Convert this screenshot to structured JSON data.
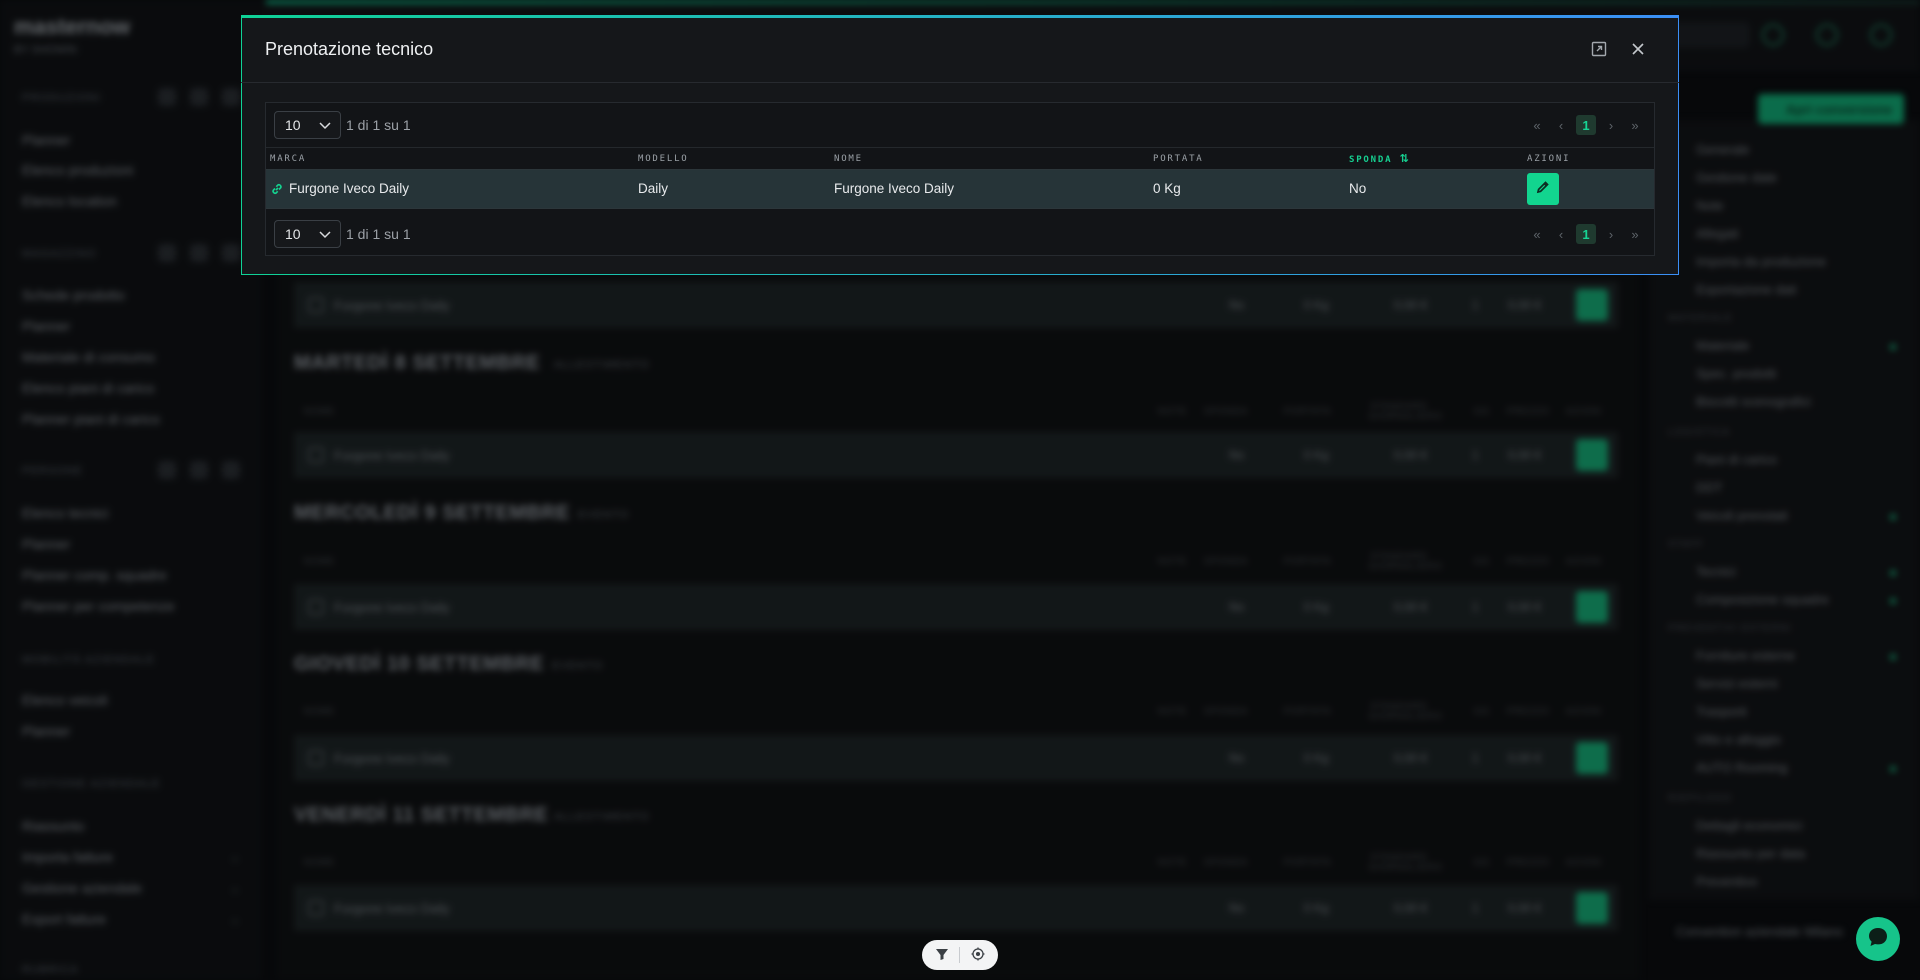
{
  "background": {
    "logo": "masternow",
    "logo_sub": "BY SHOWIN",
    "sidebar": {
      "sections": [
        {
          "title": "Produzioni",
          "items": [
            "Planner",
            "Elenco produzioni",
            "Elenco location"
          ]
        },
        {
          "title": "Magazzino",
          "items": [
            "Schede prodotto",
            "Planner",
            "Materiale di consumo",
            "Elenco piani di carico",
            "Planner piani di carico"
          ]
        },
        {
          "title": "Persone",
          "items": [
            "Elenco tecnici",
            "Planner",
            "Planner comp. squadre",
            "Planner per competenze"
          ]
        },
        {
          "title": "Mobilità aziendale",
          "items": [
            "Elenco veicoli",
            "Planner"
          ]
        },
        {
          "title": "Gestione aziendale",
          "items": [
            "Riassunto",
            "Importa fatture",
            "Gestione aziendale",
            "Export fatture"
          ]
        },
        {
          "title": "Rubrica",
          "items": []
        }
      ]
    },
    "days": [
      {
        "title": "MARTEDÌ 8 SETTEMBRE",
        "tag": "ALLESTIMENTO"
      },
      {
        "title": "MERCOLEDÌ 9 SETTEMBRE",
        "tag": "EVENTO"
      },
      {
        "title": "GIOVEDÌ 10 SETTEMBRE",
        "tag": "EVENTO"
      },
      {
        "title": "VENERDÌ 11 SETTEMBRE",
        "tag": "ALLESTIMENTO"
      }
    ],
    "rows": {
      "name": "Furgone Iveco Daily",
      "sponda": "No",
      "portata": "0 Kg",
      "costo": "0,00 €",
      "gg": "1",
      "prezzo": "0,00 €"
    },
    "table_head": [
      "NOME",
      "NOTE",
      "SPONDA",
      "PORTATA",
      "STANDARD GIORNALIERO",
      "GG",
      "PREZZO",
      "AZIONI"
    ],
    "right_panel": {
      "button": "Apri conversione",
      "items": [
        "Generale",
        "Gestione date",
        "Note",
        "Allegati",
        "Importa da produzione",
        "Esportazione dati",
        "Materiale",
        "Spec. prodotti",
        "Biscotti scenografici",
        "Piani di carico",
        "DDT",
        "Veicoli prenotati",
        "Tecnici",
        "Composizione squadre",
        "Forniture esterne",
        "Servizi esterni",
        "Trasporti",
        "Vitto e alloggio",
        "AUTO Rooming",
        "Dettagli economici",
        "Riassunto per data",
        "Preventivo"
      ],
      "sections": [
        "MATERIALE",
        "LOGISTICA",
        "STAFF",
        "PREVENTIVI ESTERNI",
        "RIEPILOGO"
      ],
      "footer": "Convention aziendale Milano"
    }
  },
  "modal": {
    "title": "Prenotazione tecnico",
    "expand_icon": "expand-icon",
    "close_icon": "close-icon",
    "per_page": "10",
    "page_info": "1 di 1 su 1",
    "current_page": "1",
    "columns": [
      "MARCA",
      "MODELLO",
      "NOME",
      "PORTATA",
      "SPONDA",
      "AZIONI"
    ],
    "rows": [
      {
        "marca": "Furgone Iveco Daily",
        "modello": "Daily",
        "nome": "Furgone Iveco Daily",
        "portata": "0 Kg",
        "sponda": "No"
      }
    ],
    "accent_color": "#12d58f"
  },
  "float_icons": [
    "filter-icon",
    "target-icon"
  ],
  "chat_icon": "chat-icon"
}
